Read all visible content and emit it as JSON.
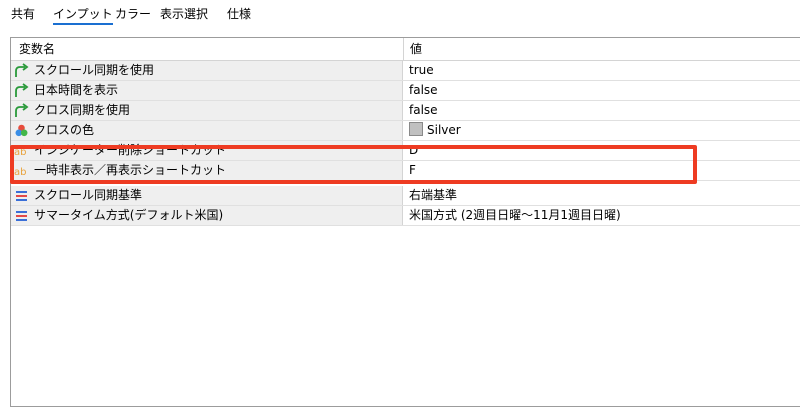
{
  "tabs": [
    "共有",
    "インプット",
    "カラー",
    "表示選択",
    "仕様"
  ],
  "active_tab": "インプット",
  "table": {
    "headers": {
      "name": "変数名",
      "value": "値"
    },
    "rows": [
      {
        "icon": "bool-arrow-icon",
        "name": "スクロール同期を使用",
        "value": "true"
      },
      {
        "icon": "bool-arrow-icon",
        "name": "日本時間を表示",
        "value": "false"
      },
      {
        "icon": "bool-arrow-icon",
        "name": "クロス同期を使用",
        "value": "false"
      },
      {
        "icon": "color-circles-icon",
        "name": "クロスの色",
        "value": "Silver",
        "swatch_color": "#c0c0c0"
      },
      {
        "icon": "string-ab-icon",
        "name": "インジケーター削除ショートカット",
        "value": "D"
      },
      {
        "icon": "string-ab-icon",
        "name": "一時非表示／再表示ショートカット",
        "value": "F"
      },
      {
        "icon": "enum-list-icon",
        "name": "スクロール同期基準",
        "value": "右端基準"
      },
      {
        "icon": "enum-list-icon",
        "name": "サマータイム方式(デフォルト米国)",
        "value": "米国方式 (2週目日曜～11月1週目日曜)"
      }
    ]
  },
  "colors": {
    "highlight": "#ee3b22",
    "active_tab_underline": "#1a6fd1"
  }
}
